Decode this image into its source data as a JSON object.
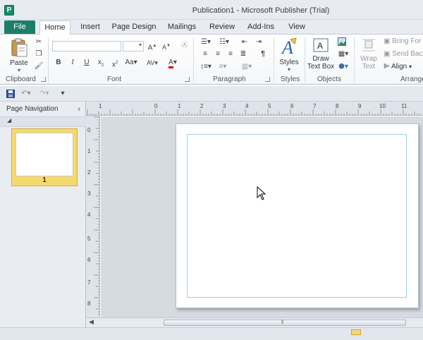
{
  "window": {
    "title": "Publication1 - Microsoft Publisher (Trial)",
    "app_icon": "P"
  },
  "tabs": [
    {
      "label": "File"
    },
    {
      "label": "Home"
    },
    {
      "label": "Insert"
    },
    {
      "label": "Page Design"
    },
    {
      "label": "Mailings"
    },
    {
      "label": "Review"
    },
    {
      "label": "Add-Ins"
    },
    {
      "label": "View"
    }
  ],
  "ribbon": {
    "clipboard": {
      "label": "Clipboard",
      "paste": "Paste"
    },
    "font": {
      "label": "Font"
    },
    "paragraph": {
      "label": "Paragraph"
    },
    "styles": {
      "label": "Styles",
      "button": "Styles"
    },
    "objects": {
      "label": "Objects",
      "draw_text_box_1": "Draw",
      "draw_text_box_2": "Text Box"
    },
    "arrange": {
      "label": "Arrange",
      "wrap_text_1": "Wrap",
      "wrap_text_2": "Text",
      "bring_forward": "Bring For",
      "send_backward": "Send Bac",
      "align": "Align"
    }
  },
  "nav_pane": {
    "title": "Page Navigation",
    "page_number": "1"
  },
  "rulers": {
    "horizontal": [
      "1",
      "0",
      "1",
      "2",
      "3",
      "4",
      "5",
      "6",
      "7",
      "8",
      "9",
      "10",
      "11"
    ],
    "vertical": [
      "0",
      "1",
      "2",
      "3",
      "4",
      "5",
      "6",
      "7",
      "8"
    ]
  }
}
